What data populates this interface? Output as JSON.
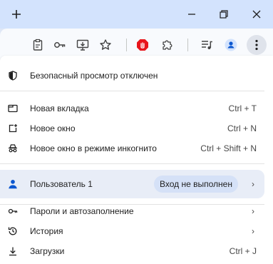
{
  "titlebar": {
    "new_tab_icon": "plus-icon",
    "minimize_icon": "minimize-icon",
    "restore_icon": "restore-icon",
    "close_icon": "close-icon"
  },
  "toolbar": {
    "icons": [
      "clipboard-icon",
      "key-icon",
      "install-app-icon",
      "bookmark-star-icon",
      "adblock-extension-icon",
      "extensions-puzzle-icon",
      "media-queue-icon",
      "profile-avatar-icon",
      "kebab-menu-icon"
    ],
    "adblock_color": "#e8151b",
    "accent": "#0b57d0"
  },
  "menu": {
    "safe_browsing": "Безопасный просмотр отключен",
    "items_group1": [
      {
        "label": "Новая вкладка",
        "shortcut": "Ctrl + T",
        "icon": "new-tab-icon"
      },
      {
        "label": "Новое окно",
        "shortcut": "Ctrl + N",
        "icon": "new-window-icon"
      },
      {
        "label": "Новое окно в режиме инкогнито",
        "shortcut": "Ctrl + Shift + N",
        "icon": "incognito-icon"
      }
    ],
    "profile": {
      "name": "Пользователь 1",
      "status": "Вход не выполнен"
    },
    "items_group2": [
      {
        "label": "Пароли и автозаполнение",
        "icon": "key-icon"
      },
      {
        "label": "История",
        "icon": "history-icon"
      },
      {
        "label": "Загрузки",
        "shortcut": "Ctrl + J",
        "icon": "download-icon"
      }
    ]
  }
}
